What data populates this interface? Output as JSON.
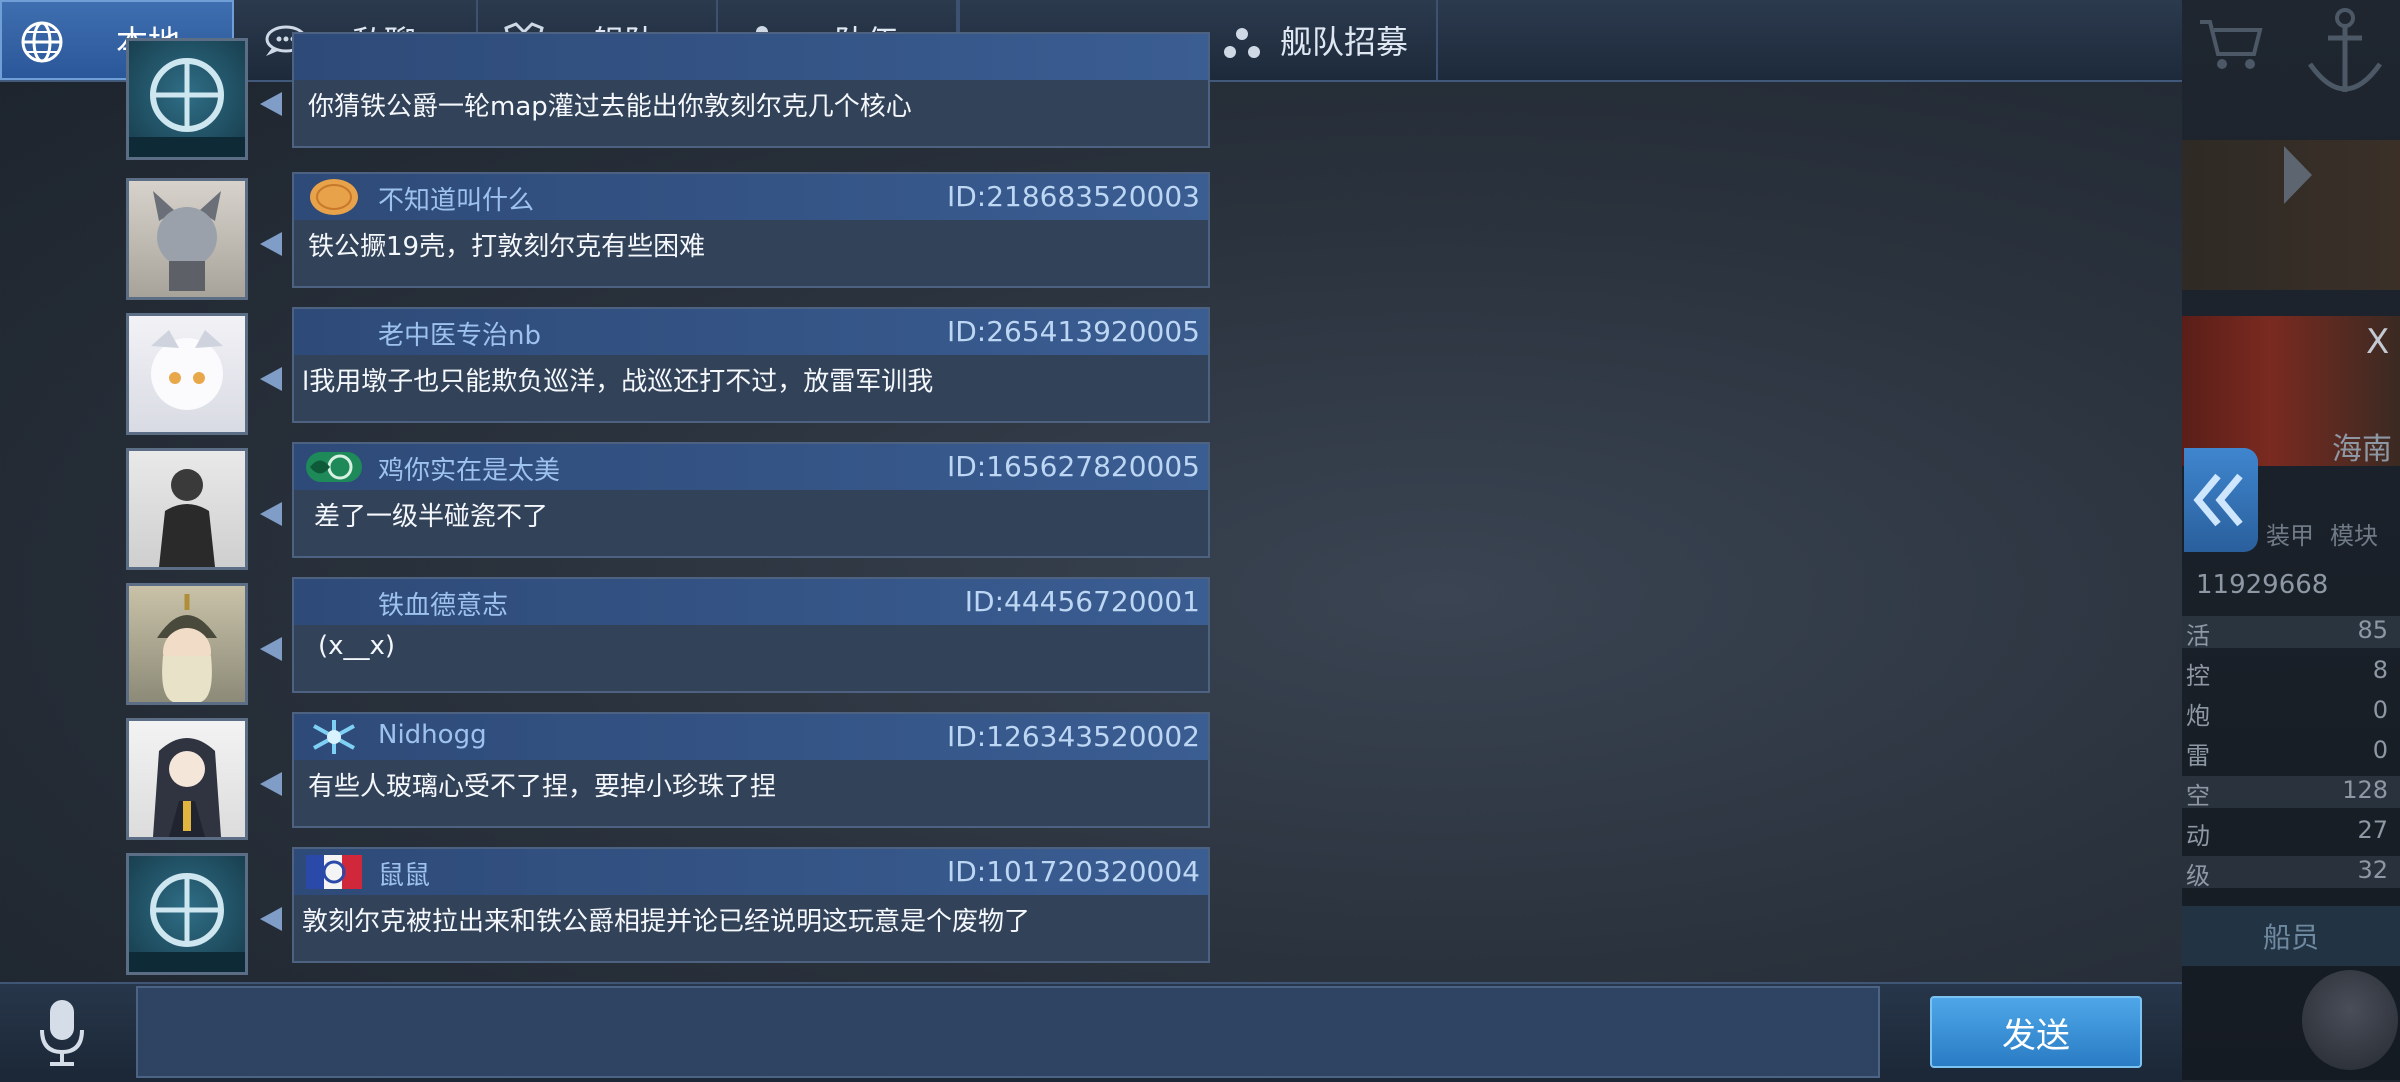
{
  "tabs": [
    {
      "label": "本地",
      "icon": "globe-icon",
      "active": true
    },
    {
      "label": "私聊",
      "icon": "chat-bubble-icon",
      "active": false
    },
    {
      "label": "舰队",
      "icon": "fleet-emblem-icon",
      "active": false
    },
    {
      "label": "队伍",
      "icon": "team-dots-icon",
      "active": false
    },
    {
      "label": "舰队招募",
      "icon": "team-dots-icon",
      "active": false
    }
  ],
  "messages": [
    {
      "username": "",
      "id": "",
      "text": "你猜铁公爵一轮map灌过去能出你敦刻尔克几个核心",
      "badge": "flag-badge-icon",
      "avatar": "navy-emblem-avatar"
    },
    {
      "username": "不知道叫什么",
      "id": "ID:218683520003",
      "text": "铁公撅19壳，打敦刻尔克有些困难",
      "badge": "cookie-badge-icon",
      "avatar": "anime-cat-girl-avatar"
    },
    {
      "username": "老中医专治nb",
      "id": "ID:265413920005",
      "text": "l我用墩子也只能欺负巡洋，战巡还打不过，放雷军训我",
      "badge": "",
      "avatar": "anime-white-hair-avatar"
    },
    {
      "username": "鸡你实在是太美",
      "id": "ID:165627820005",
      "text": "差了一级半碰瓷不了",
      "badge": "green-emblem-badge-icon",
      "avatar": "person-photo-avatar"
    },
    {
      "username": "铁血德意志",
      "id": "ID:44456720001",
      "text": "(x__x)",
      "badge": "",
      "avatar": "helmet-girl-avatar"
    },
    {
      "username": "Nidhogg",
      "id": "ID:126343520002",
      "text": "有些人玻璃心受不了捏，要掉小珍珠了捏",
      "badge": "snowflake-badge-icon",
      "avatar": "anime-dark-hair-avatar"
    },
    {
      "username": "鼠鼠",
      "id": "ID:101720320004",
      "text": "敦刻尔克被拉出来和铁公爵相提并论已经说明这玩意是个废物了",
      "badge": "french-flag-badge-icon",
      "avatar": "navy-emblem-avatar"
    }
  ],
  "input": {
    "placeholder": ""
  },
  "send_label": "发送",
  "right_panel": {
    "ship_name": "海南",
    "close": "X",
    "tab_armor": "装甲",
    "tab_module": "模块",
    "power": "11929668",
    "stats": [
      {
        "k": "活",
        "v": "85"
      },
      {
        "k": "控",
        "v": "8"
      },
      {
        "k": "炮",
        "v": "0"
      },
      {
        "k": "雷",
        "v": "0"
      },
      {
        "k": "空",
        "v": "128"
      },
      {
        "k": "动",
        "v": "27"
      },
      {
        "k": "级",
        "v": "32"
      }
    ],
    "crew_button": "船员"
  },
  "colors": {
    "accent": "#2a7cc4",
    "bubble": "#324258",
    "header": "#3a5d92",
    "tab_active": "#3f6fb0"
  }
}
